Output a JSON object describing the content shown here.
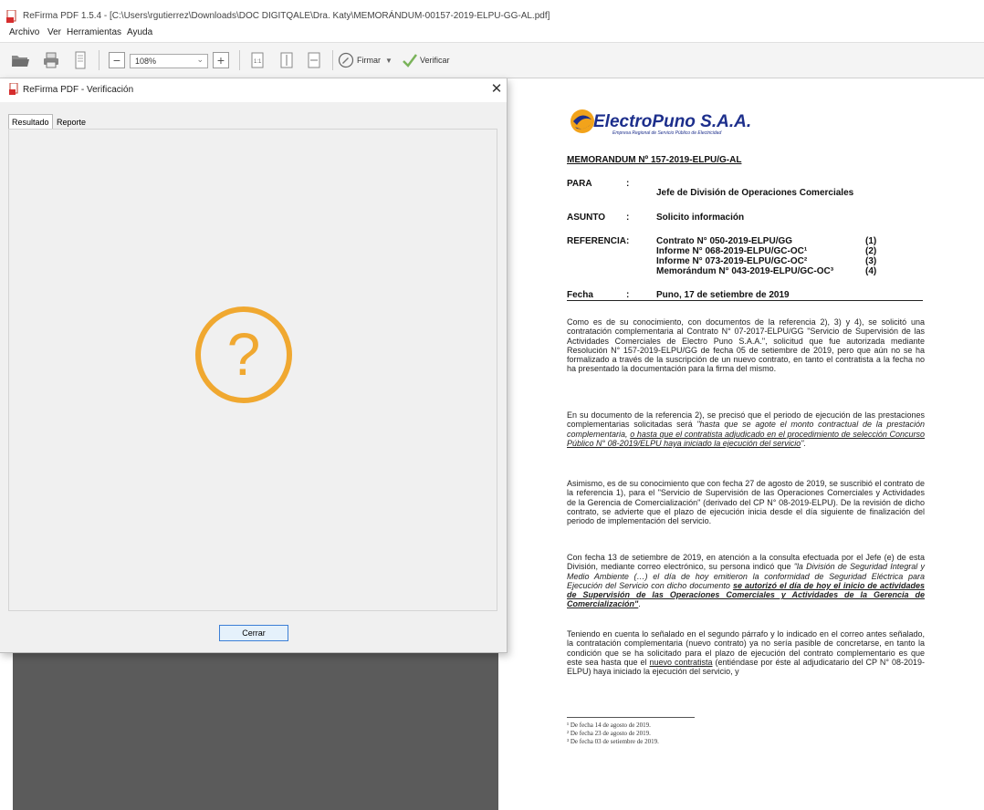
{
  "window": {
    "title": "ReFirma PDF 1.5.4 - [C:\\Users\\rgutierrez\\Downloads\\DOC DIGITQALE\\Dra. Katy\\MEMORÁNDUM-00157-2019-ELPU-GG-AL.pdf]"
  },
  "menu": [
    "Archivo",
    "Ver",
    "Herramientas",
    "Ayuda"
  ],
  "toolbar": {
    "zoom": "108%",
    "sign_label": "Firmar",
    "verify_label": "Verificar"
  },
  "dialog": {
    "title": "ReFirma PDF - Verificación",
    "close_symbol": "✕",
    "tabs": [
      "Resultado",
      "Reporte"
    ],
    "status_icon": "question-mark",
    "close_button": "Cerrar",
    "accent_color": "#f0a830"
  },
  "document": {
    "logo": "ElectroPuno S.A.A.",
    "logo_subtitle": "Empresa Regional de Servicio Público de Electricidad",
    "memo_title": "MEMORANDUM Nº 157-2019-ELPU/G-AL",
    "para_label": "PARA",
    "para_value": "Jefe de División de Operaciones Comerciales",
    "asunto_label": "ASUNTO",
    "asunto_value": "Solicito información",
    "ref_label": "REFERENCIA:",
    "references": [
      {
        "text": "Contrato N° 050-2019-ELPU/GG",
        "num": "(1)"
      },
      {
        "text": "Informe N° 068-2019-ELPU/GC-OC¹",
        "num": "(2)"
      },
      {
        "text": "Informe N° 073-2019-ELPU/GC-OC²",
        "num": "(3)"
      },
      {
        "text": "Memorándum N° 043-2019-ELPU/GC-OC³",
        "num": "(4)"
      }
    ],
    "fecha_label": "Fecha",
    "fecha_value": "Puno, 17 de setiembre de 2019",
    "colon": ":",
    "p1": "Como es de su conocimiento, con documentos de la referencia 2), 3) y 4), se solicitó una contratación complementaria al Contrato N° 07-2017-ELPU/GG \"Servicio de Supervisión de las Actividades Comerciales de Electro Puno S.A.A.\", solicitud que fue autorizada mediante Resolución N° 157-2019-ELPU/GG de fecha 05 de setiembre de 2019, pero que aún no se ha formalizado a través de la suscripción de un nuevo contrato, en tanto el contratista a la fecha no ha presentado la documentación para la firma del mismo.",
    "p2_a": "En su documento de la referencia 2), se precisó que el periodo de ejecución de las prestaciones complementarias solicitadas será ",
    "p2_b": "\"hasta que se agote el monto contractual de la prestación complementaria, ",
    "p2_c": "o hasta que el contratista adjudicado en el procedimiento de selección Concurso Público N° 08-2019/ELPU haya iniciado la ejecución del servicio",
    "p2_d": "\".",
    "p3": "Asimismo, es de su conocimiento que con fecha 27 de agosto de 2019, se suscribió el contrato de la referencia 1), para el \"Servicio de Supervisión de las Operaciones Comerciales y Actividades de la Gerencia de Comercialización\" (derivado del CP N° 08-2019-ELPU). De la revisión de dicho contrato, se advierte que el plazo de ejecución inicia desde el día siguiente de finalización del periodo de implementación del servicio.",
    "p4_a": "Con fecha 13 de setiembre de 2019, en atención a la consulta efectuada por el Jefe (e) de esta División, mediante correo electrónico, su persona indicó que ",
    "p4_b": "\"la División de Seguridad Integral y Medio Ambiente (…) el día de hoy emitieron la conformidad de Seguridad Eléctrica para Ejecución del Servicio con dicho documento ",
    "p4_c": "se autorizó el día de hoy el inicio de actividades de Supervisión de las Operaciones Comerciales y Actividades de la Gerencia de Comercialización\"",
    "p4_d": ".",
    "p5_a": "Teniendo en cuenta lo señalado en el segundo párrafo y lo indicado en el correo antes señalado, la contratación complementaria (nuevo contrato) ya no sería pasible de concretarse, en tanto la condición que se ha solicitado para el plazo de ejecución del contrato complementario es que este sea hasta que el ",
    "p5_b": "nuevo contratista",
    "p5_c": " (entiéndase por éste al adjudicatario del CP N° 08-2019-ELPU) haya iniciado la ejecución del servicio, y",
    "footnotes": [
      "¹ De fecha 14 de agosto de 2019.",
      "² De fecha 23 de agosto de 2019.",
      "³ De fecha 03 de setiembre de 2019."
    ]
  }
}
